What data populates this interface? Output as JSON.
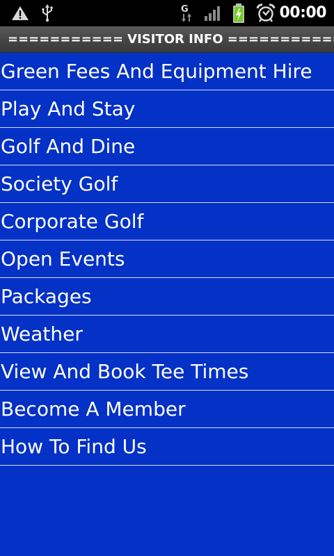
{
  "status_bar": {
    "time": "00:00",
    "icons": [
      "warning-icon",
      "usb-icon",
      "gprs-data-icon",
      "signal-icon",
      "battery-charging-icon",
      "alarm-clock-icon"
    ]
  },
  "title_bar": {
    "title": "=========== VISITOR INFO ==========="
  },
  "menu": {
    "items": [
      {
        "label": "Green Fees And Equipment Hire"
      },
      {
        "label": "Play And Stay"
      },
      {
        "label": "Golf And Dine"
      },
      {
        "label": "Society Golf"
      },
      {
        "label": "Corporate Golf"
      },
      {
        "label": "Open Events"
      },
      {
        "label": "Packages"
      },
      {
        "label": "Weather"
      },
      {
        "label": "View And Book Tee Times"
      },
      {
        "label": "Become A Member"
      },
      {
        "label": "How To Find Us"
      }
    ]
  },
  "colors": {
    "background": "#0431c6",
    "divider": "#d7dff8",
    "status_bar": "#000000",
    "title_bar": "#464646",
    "text": "#ffffff"
  }
}
